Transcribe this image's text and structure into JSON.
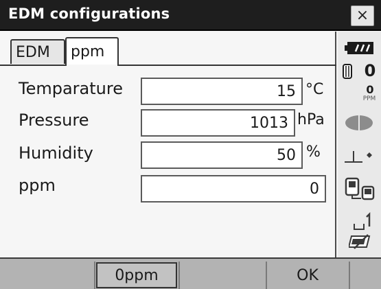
{
  "window": {
    "title": "EDM configurations",
    "close_glyph": "×"
  },
  "tabs": [
    {
      "label": "EDM",
      "active": false
    },
    {
      "label": "ppm",
      "active": true
    }
  ],
  "form": {
    "temperature": {
      "label": "Temparature",
      "value": "15",
      "unit": "°C"
    },
    "pressure": {
      "label": "Pressure",
      "value": "1013",
      "unit": "hPa"
    },
    "humidity": {
      "label": "Humidity",
      "value": "50",
      "unit": "%"
    },
    "ppm": {
      "label": "ppm",
      "value": "0"
    }
  },
  "softkeys": {
    "zero_ppm": "0ppm",
    "ok": "OK"
  },
  "status": {
    "prism_constant": "0",
    "ppm_value": "0",
    "ppm_unit": "PPM",
    "icons": [
      "battery-icon",
      "prism-icon",
      "laser-beam-icon",
      "tilt-icon",
      "bluetooth-communication-icon",
      "input-mode-icon",
      "memory-card-icon"
    ]
  }
}
